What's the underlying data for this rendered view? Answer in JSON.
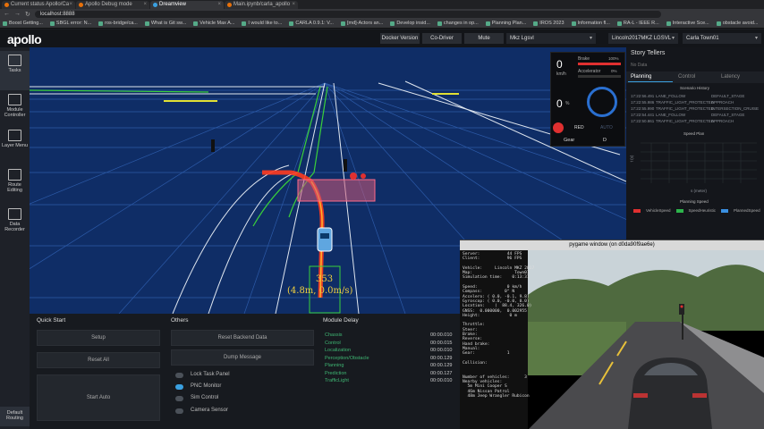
{
  "browser": {
    "tabs": [
      {
        "label": "Current status Apollo/Ca",
        "active": false
      },
      {
        "label": "Apollo Debug mode",
        "active": false
      },
      {
        "label": "Dreamview",
        "active": true
      },
      {
        "label": "Main.ipynb/carla_apollo",
        "active": false
      }
    ],
    "url": "localhost:8888",
    "bookmarks": [
      "Boost Getting...",
      "SBGL error: N...",
      "ros-bridge/ca...",
      "What is Git sw...",
      "Vehicle Max A...",
      "I would like to...",
      "CARLA 0.9.1: V...",
      "[md]-Actors an...",
      "Develop insid...",
      "changes in op...",
      "Planning Plan...",
      "IROS 2023",
      "Information fl...",
      "RA-L - IEEE R...",
      "Interactive Sce...",
      "obstacle avoid..."
    ]
  },
  "header": {
    "logo": "apollo",
    "docker_btn": "Docker Version",
    "codriver_btn": "Co-Driver",
    "mute_btn": "Mute",
    "mode_select": "Mkz Lgsvl",
    "vehicle_select": "Lincoln2017MKZ LGSVL",
    "map_select": "Carla Town01"
  },
  "sidebar": {
    "items": [
      {
        "label": "Tasks"
      },
      {
        "label": "Module Controller"
      },
      {
        "label": "Layer Menu"
      },
      {
        "label": "Route Editing"
      },
      {
        "label": "Data Recorder"
      },
      {
        "label": "Default Routing"
      }
    ]
  },
  "hud": {
    "speed": "0",
    "speed_unit": "km/h",
    "brake_label": "Brake",
    "brake_pct": "100%",
    "accel_label": "Accelerator",
    "accel_pct": "0%",
    "steer": "0",
    "steer_unit": "%",
    "manual_label": "MANUAL",
    "red_label": "RED",
    "auto_label": "AUTO",
    "gear_label": "Gear",
    "gear_value": "D"
  },
  "viewport": {
    "id_label": "353",
    "pos_label": "(4.8m, 0.0m/s)"
  },
  "story": {
    "title": "Story Tellers",
    "no_data": "No Data",
    "tabs": [
      "Planning",
      "Control",
      "Latency"
    ],
    "scenario_title": "Scenario History",
    "scenario_rows": [
      [
        "17:22:56.491",
        "LANE_FOLLOW",
        "DEFAULT_STAGE"
      ],
      [
        "17:22:55.986",
        "TRAFFIC_LIGHT_PROTECTED",
        "APPROACH"
      ],
      [
        "17:22:55.990",
        "TRAFFIC_LIGHT_PROTECTED",
        "INTERSECTION_CRUISE"
      ],
      [
        "17:22:54.441",
        "LANE_FOLLOW",
        "DEFAULT_STAGE"
      ],
      [
        "17:22:50.861",
        "TRAFFIC_LIGHT_PROTECTED",
        "APPROACH"
      ]
    ],
    "speed_plan_title": "Speed Plan",
    "y_label": "t (s)",
    "x_label": "s (meter)",
    "planning_speed_title": "Planning Speed",
    "legend": [
      "VehicleSpeed",
      "SpeedHeuristic",
      "PlannedSpeed"
    ]
  },
  "quickstart": {
    "title": "Quick Start",
    "setup": "Setup",
    "reset_all": "Reset All",
    "start_auto": "Start Auto"
  },
  "others": {
    "title": "Others",
    "reset_backend": "Reset Backend Data",
    "dump_message": "Dump Message",
    "toggles": [
      {
        "label": "Lock Task Panel",
        "on": false
      },
      {
        "label": "PNC Monitor",
        "on": true
      },
      {
        "label": "Sim Control",
        "on": false
      },
      {
        "label": "Camera Sensor",
        "on": false
      }
    ]
  },
  "module_delay": {
    "title": "Module Delay",
    "rows": [
      {
        "name": "Chassis",
        "value": "00:00.010"
      },
      {
        "name": "Control",
        "value": "00:00.015"
      },
      {
        "name": "Localization",
        "value": "00:00.010"
      },
      {
        "name": "Perception/Obstacle",
        "value": "00:00.129"
      },
      {
        "name": "Planning",
        "value": "00:00.129"
      },
      {
        "name": "Prediction",
        "value": "00:00.127"
      },
      {
        "name": "TrafficLight",
        "value": "00:00.010"
      }
    ]
  },
  "pygame": {
    "title": "pygame window (on d0da90f9ae6e)",
    "hud_text": "Server:           44 FPS\nClient:           96 FPS\n\nVehicle:     Lincoln MKZ 2017\nMap:                 Town01\nSimulation time:    0:13:31\n\nSpeed:            0 km/h\nCompass:         0° N\nAccelero: ( 0.0, -0.1, 9.8)\nGyroscop: ( 0.0, -0.0, 0.0)\nLocation:    (  88.4, 326.0)\nGNSS:  0.000000,  0.002955\nHeight:            0 m\n\nThrottle:\nSteer:\nBrake:\nReverse:\nHand brake:\nManual:\nGear:             1\n\nCollision:\n\n\nNumber of vehicles:      3\nNearby vehicles:\n  5m Mini Cooper S\n  46m Nissan Patrol\n  48m Jeep Wrangler Rubicon"
  },
  "colors": {
    "viewport_bg": "#0f2d66",
    "module_delay_green": "#3fb673",
    "red_light": "#e03030",
    "route_red": "#ff3b1f"
  }
}
